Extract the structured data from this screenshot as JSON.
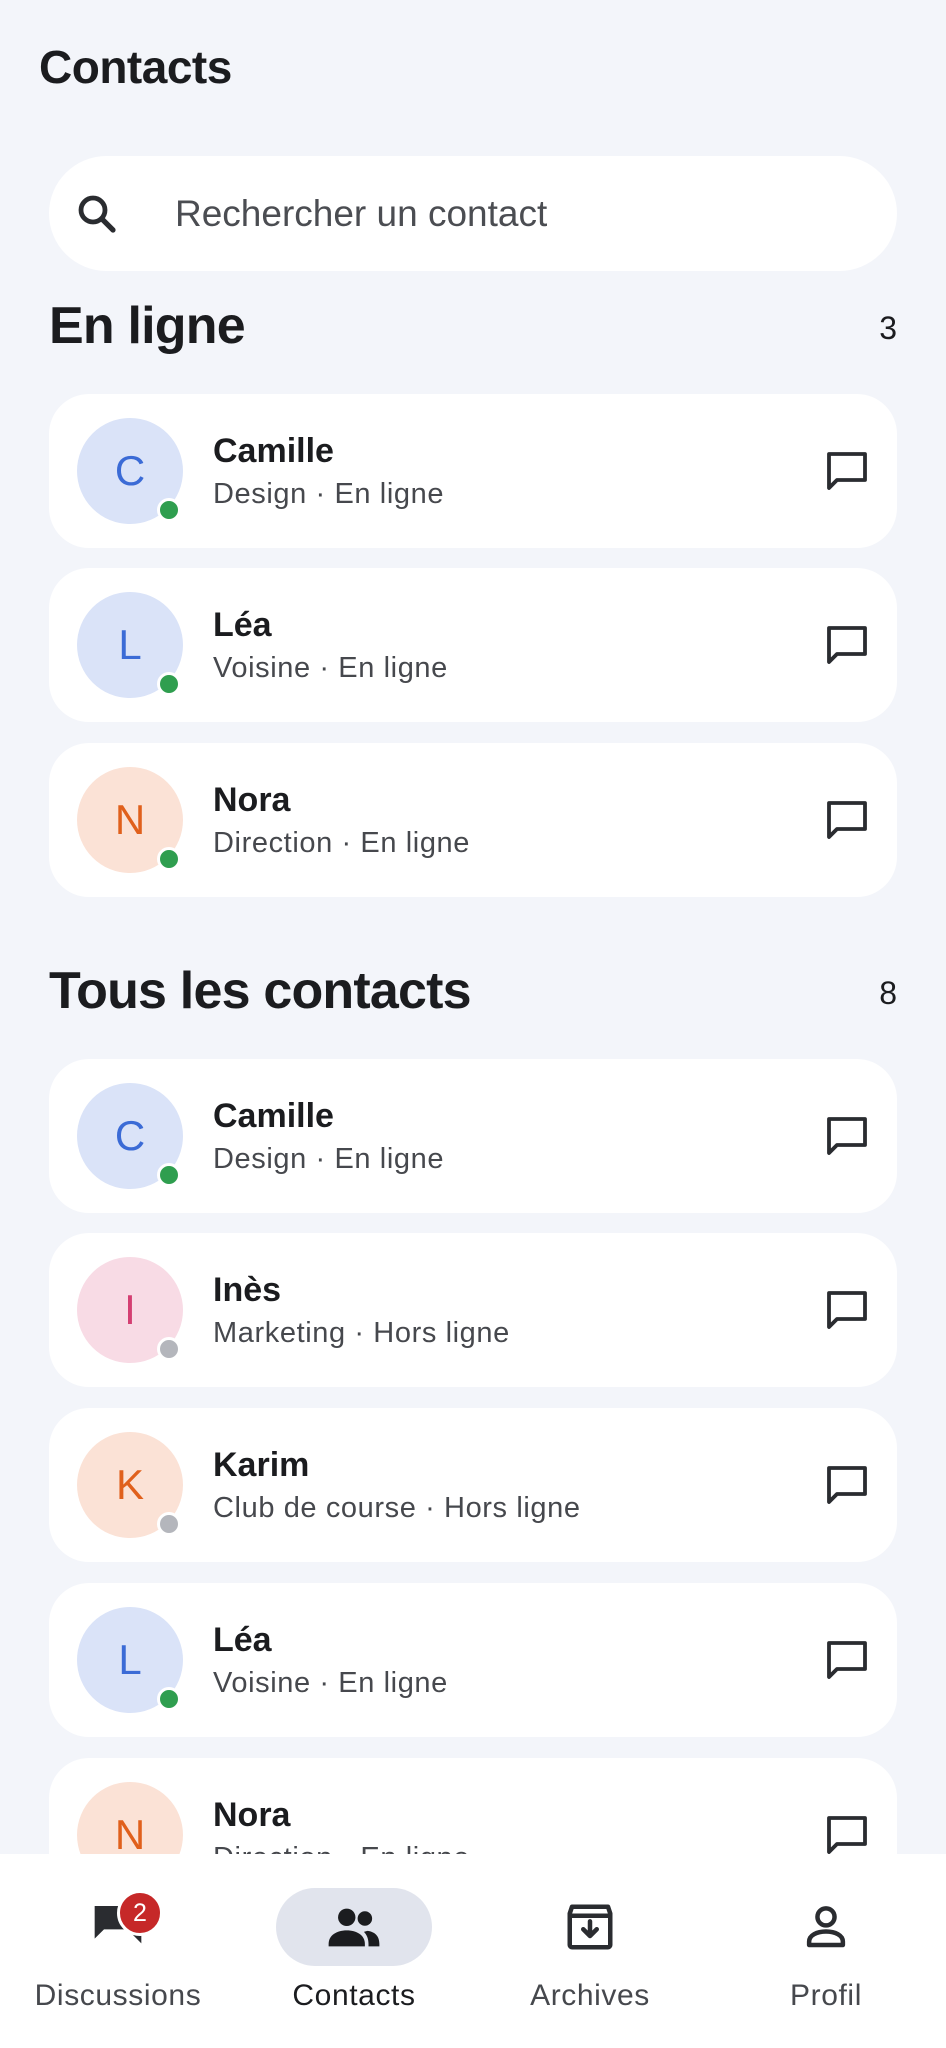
{
  "app": {
    "title": "Contacts"
  },
  "search": {
    "placeholder": "Rechercher un contact"
  },
  "online_section": {
    "title": "En ligne",
    "count": "3",
    "contacts": [
      {
        "initial": "C",
        "name": "Camille",
        "subtitle": "Design · En ligne",
        "status": "online",
        "avatar_color": "blue"
      },
      {
        "initial": "L",
        "name": "Léa",
        "subtitle": "Voisine · En ligne",
        "status": "online",
        "avatar_color": "blue"
      },
      {
        "initial": "N",
        "name": "Nora",
        "subtitle": "Direction · En ligne",
        "status": "online",
        "avatar_color": "peach"
      }
    ]
  },
  "all_section": {
    "title": "Tous les contacts",
    "count": "8",
    "contacts": [
      {
        "initial": "C",
        "name": "Camille",
        "subtitle": "Design · En ligne",
        "status": "online",
        "avatar_color": "blue"
      },
      {
        "initial": "I",
        "name": "Inès",
        "subtitle": "Marketing · Hors ligne",
        "status": "offline",
        "avatar_color": "pink"
      },
      {
        "initial": "K",
        "name": "Karim",
        "subtitle": "Club de course · Hors ligne",
        "status": "offline",
        "avatar_color": "peach"
      },
      {
        "initial": "L",
        "name": "Léa",
        "subtitle": "Voisine · En ligne",
        "status": "online",
        "avatar_color": "blue"
      },
      {
        "initial": "N",
        "name": "Nora",
        "subtitle": "Direction · En ligne",
        "status": "online",
        "avatar_color": "peach"
      }
    ]
  },
  "bottom_nav": {
    "items": [
      {
        "label": "Discussions",
        "icon": "chat-bubbles-icon",
        "badge": "2",
        "active": false
      },
      {
        "label": "Contacts",
        "icon": "people-icon",
        "active": true
      },
      {
        "label": "Archives",
        "icon": "archive-icon",
        "active": false
      },
      {
        "label": "Profil",
        "icon": "person-icon",
        "active": false
      }
    ]
  },
  "colors": {
    "background": "#f3f5fa",
    "online": "#2f9e4f",
    "offline": "#b4b6bc",
    "badge": "#c62828",
    "active_pill": "#e1e4ed"
  }
}
